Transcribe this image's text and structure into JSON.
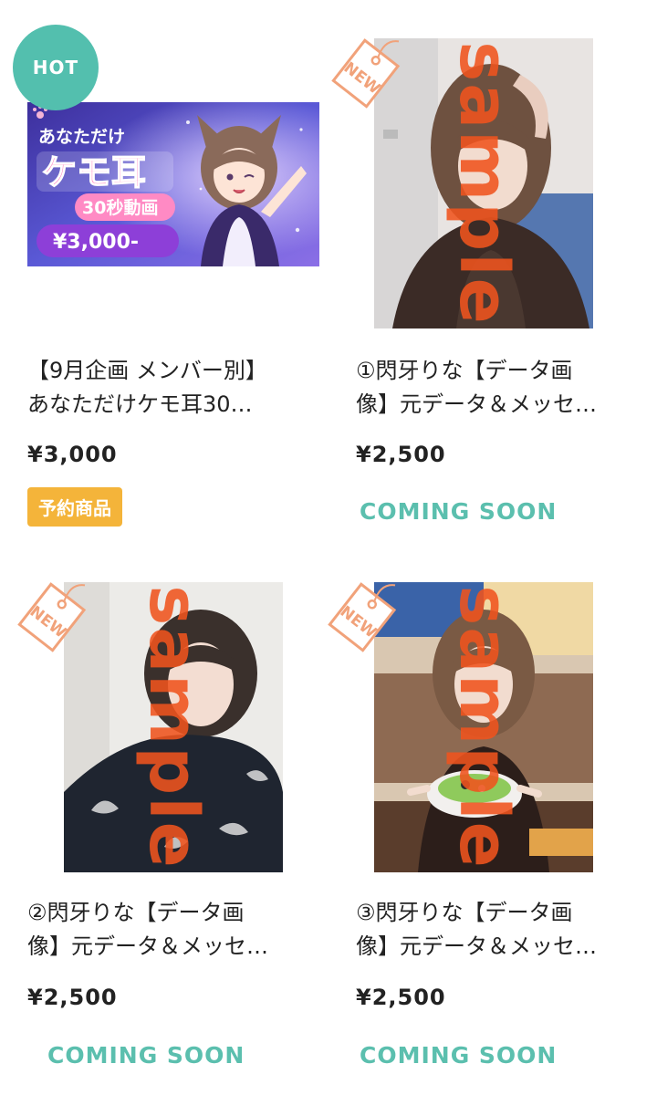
{
  "badges": {
    "hot": "HOT",
    "new": "NEW"
  },
  "watermark": "sample",
  "products": [
    {
      "title_line1": "【9月企画 メンバー別】",
      "title_line2": "あなただけケモ耳30…",
      "price": "¥3,000",
      "status_badge": "予約商品",
      "banner": {
        "line1": "あなただけ",
        "line2": "ケモ耳",
        "line3": "30秒動画",
        "price": "¥3,000-"
      }
    },
    {
      "title_line1": "①閃牙りな【データ画",
      "title_line2": "像】元データ＆メッセ…",
      "price": "¥2,500",
      "status": "COMING SOON"
    },
    {
      "title_line1": "②閃牙りな【データ画",
      "title_line2": "像】元データ＆メッセ…",
      "price": "¥2,500",
      "status": "COMING SOON"
    },
    {
      "title_line1": "③閃牙りな【データ画",
      "title_line2": "像】元データ＆メッセ…",
      "price": "¥2,500",
      "status": "COMING SOON"
    }
  ],
  "colors": {
    "accent": "#53bfae",
    "coming_soon": "#5bbfae",
    "reserve_badge": "#f4b43a",
    "watermark": "#f0541e",
    "new_tag": "#f1a27a"
  }
}
